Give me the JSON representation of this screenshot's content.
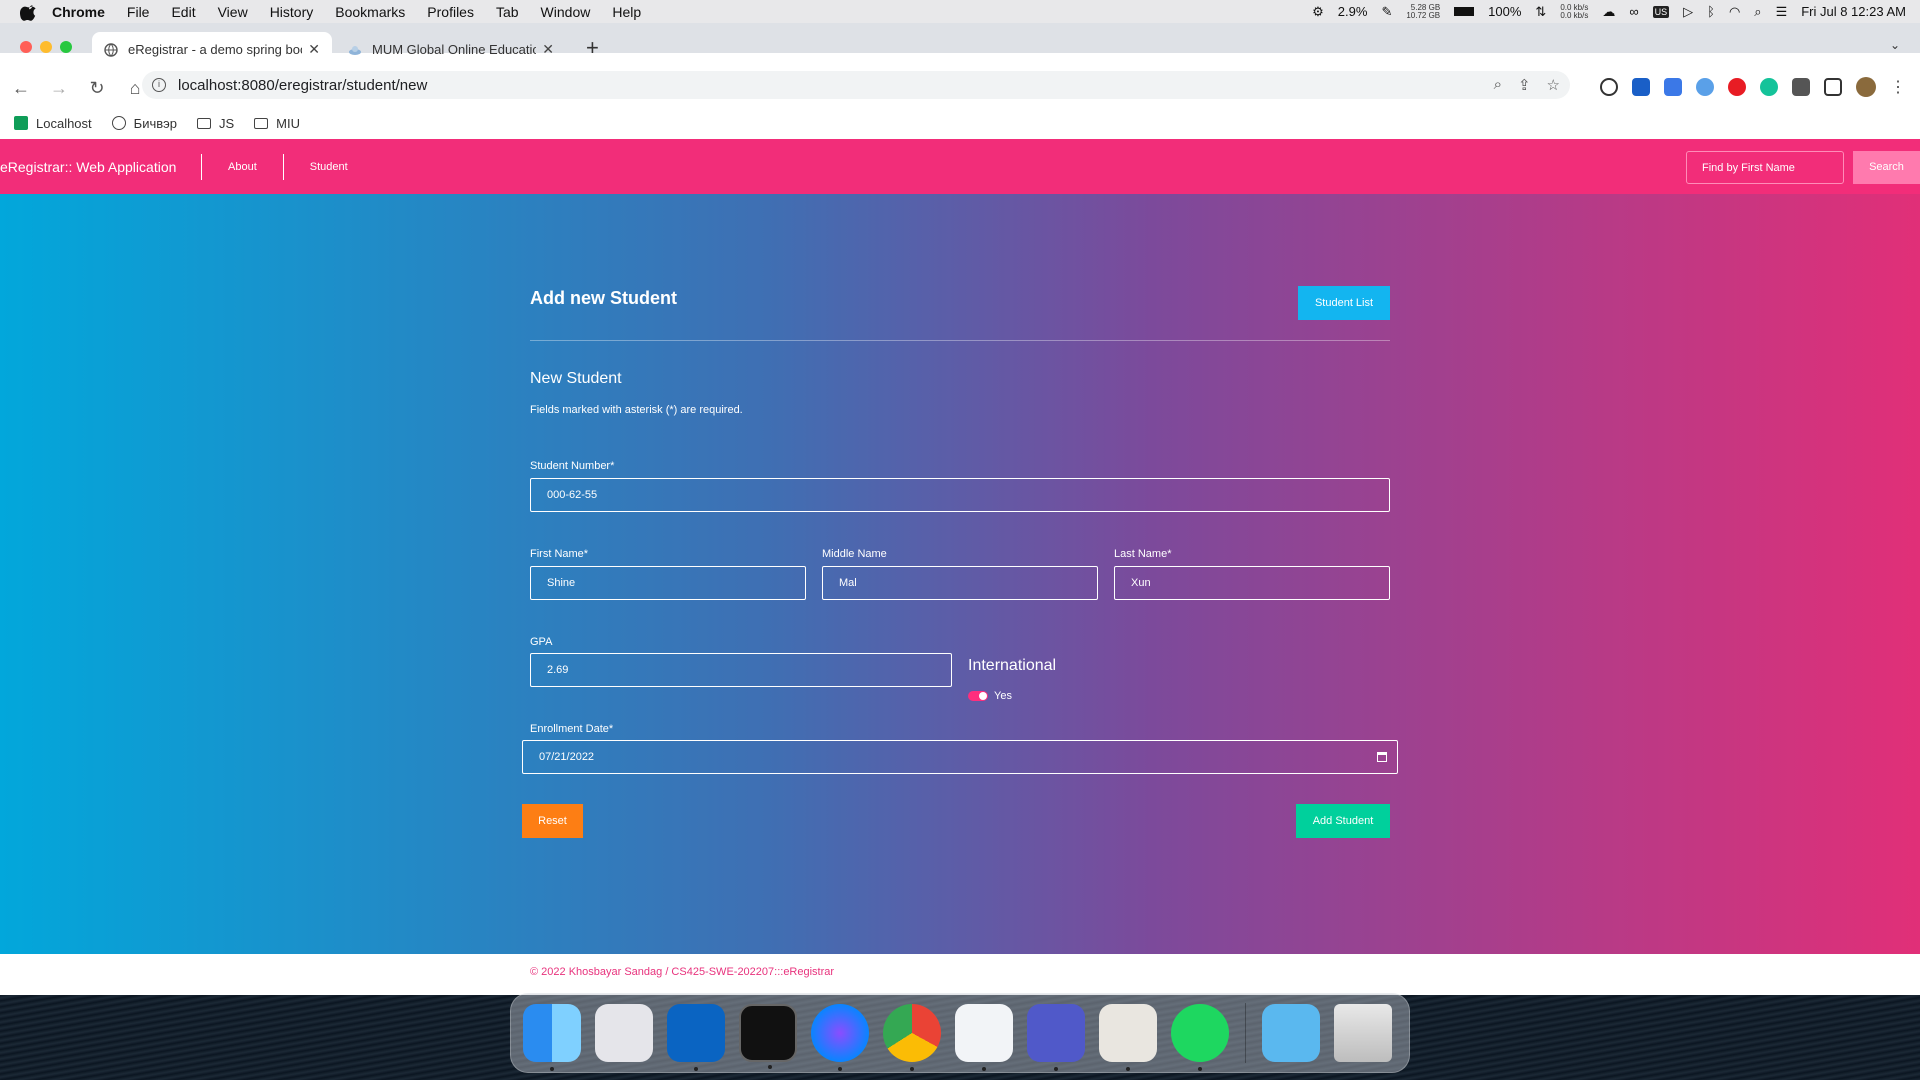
{
  "menubar": {
    "app": "Chrome",
    "items": [
      "File",
      "Edit",
      "View",
      "History",
      "Bookmarks",
      "Profiles",
      "Tab",
      "Window",
      "Help"
    ],
    "cpu": "2.9%",
    "mem_top": "5.28 GB",
    "mem_bottom": "10.72 GB",
    "battery": "100%",
    "net_up": "0.0 kb/s",
    "net_down": "0.0 kb/s",
    "lang": "US",
    "datetime": "Fri Jul 8  12:23 AM"
  },
  "browser": {
    "tabs": [
      {
        "title": "eRegistrar - a demo spring boo",
        "active": true
      },
      {
        "title": "MUM Global Online Education",
        "active": false
      }
    ],
    "url": "localhost:8080/eregistrar/student/new",
    "bookmarks": [
      "Localhost",
      "Бичвэр",
      "JS",
      "MIU"
    ]
  },
  "navbar": {
    "brand": "eRegistrar:: Web Application",
    "links": [
      "About",
      "Student"
    ],
    "search_placeholder": "Find by First Name",
    "search_button": "Search"
  },
  "page": {
    "title": "Add new Student",
    "list_button": "Student List",
    "subtitle": "New Student",
    "note": "Fields marked with asterisk (*) are required."
  },
  "form": {
    "student_number_label": "Student Number*",
    "student_number": "000-62-55",
    "first_name_label": "First Name*",
    "first_name": "Shine",
    "middle_name_label": "Middle Name",
    "middle_name": "Mal",
    "last_name_label": "Last Name*",
    "last_name": "Xun",
    "gpa_label": "GPA",
    "gpa": "2.69",
    "international_label": "International",
    "international_value": "Yes",
    "enrollment_label": "Enrollment Date*",
    "enrollment_date": "07/21/2022",
    "reset_button": "Reset",
    "submit_button": "Add Student"
  },
  "footer": {
    "text": "© 2022 Khosbayar Sandag / CS425-SWE-202207:::eRegistrar"
  },
  "colors": {
    "navbar": "#f22d79",
    "gradient_start": "#02a7db",
    "gradient_end": "#e12f78",
    "list_button": "#13b5f0",
    "reset_button": "#fd7e14",
    "submit_button": "#00d09c"
  },
  "dock": [
    "Finder",
    "Launchpad",
    "Outlook",
    "Terminal",
    "Messenger",
    "Chrome",
    "VS Code",
    "Teams",
    "Sequel Ace",
    "Spotify",
    "Downloads",
    "Trash"
  ]
}
